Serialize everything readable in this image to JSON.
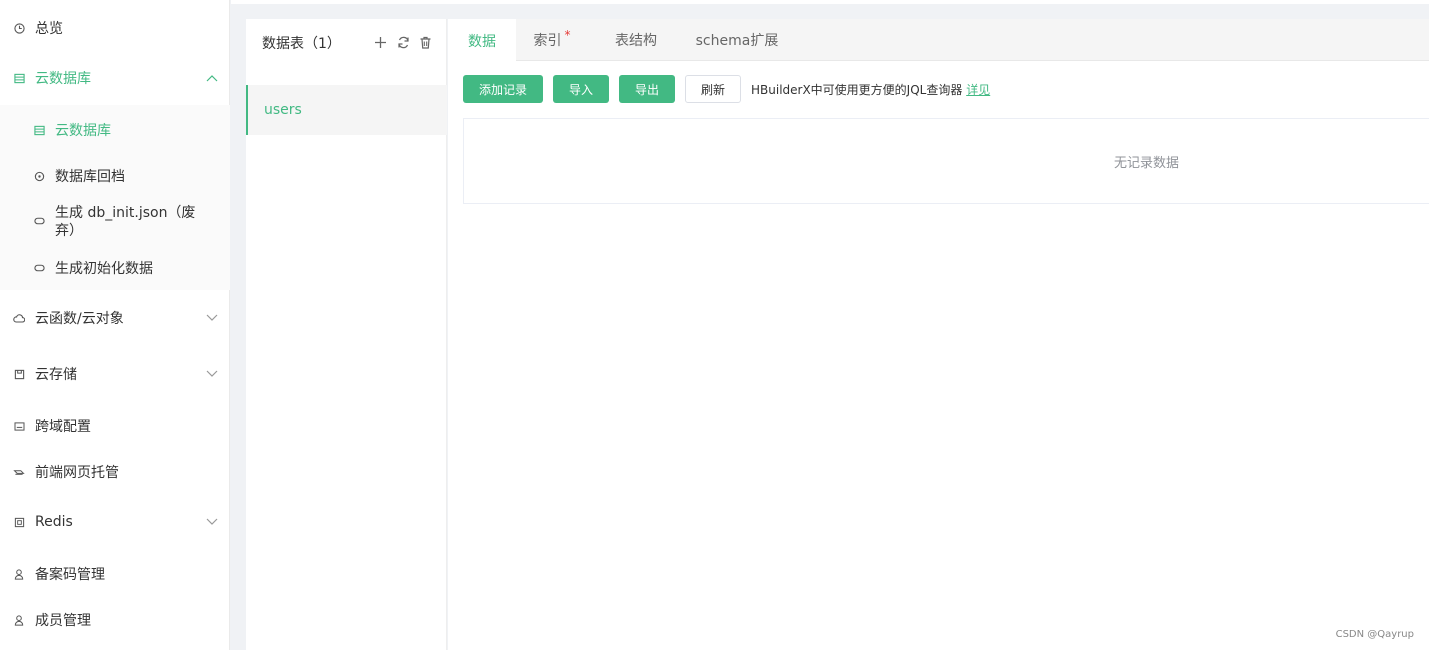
{
  "sidebar": {
    "items": [
      {
        "label": "总览",
        "icon": "clock-icon"
      },
      {
        "label": "云数据库",
        "icon": "database-icon",
        "expanded": true
      },
      {
        "label": "云数据库",
        "icon": "database-icon",
        "active": true
      },
      {
        "label": "数据库回档",
        "icon": "restore-icon"
      },
      {
        "label": "生成 db_init.json（废弃）",
        "icon": "link-icon"
      },
      {
        "label": "生成初始化数据",
        "icon": "link-icon"
      },
      {
        "label": "云函数/云对象",
        "icon": "cloud-icon"
      },
      {
        "label": "云存储",
        "icon": "storage-icon"
      },
      {
        "label": "跨域配置",
        "icon": "cors-icon"
      },
      {
        "label": "前端网页托管",
        "icon": "hosting-icon"
      },
      {
        "label": "Redis",
        "icon": "redis-icon"
      },
      {
        "label": "备案码管理",
        "icon": "user-icon"
      },
      {
        "label": "成员管理",
        "icon": "user-icon"
      }
    ]
  },
  "tables": {
    "title": "数据表（1）",
    "rows": [
      "users"
    ]
  },
  "tabs": [
    {
      "label": "数据",
      "active": true
    },
    {
      "label": "索引",
      "required": "*"
    },
    {
      "label": "表结构"
    },
    {
      "label": "schema扩展"
    }
  ],
  "toolbar": {
    "add": "添加记录",
    "import": "导入",
    "export": "导出",
    "refresh": "刷新",
    "hint": "HBuilderX中可使用更方便的JQL查询器",
    "hint_link": "详见"
  },
  "empty_text": "无记录数据",
  "watermark": "CSDN @Qayrup",
  "colors": {
    "accent": "#42b983",
    "required": "#e53935"
  }
}
